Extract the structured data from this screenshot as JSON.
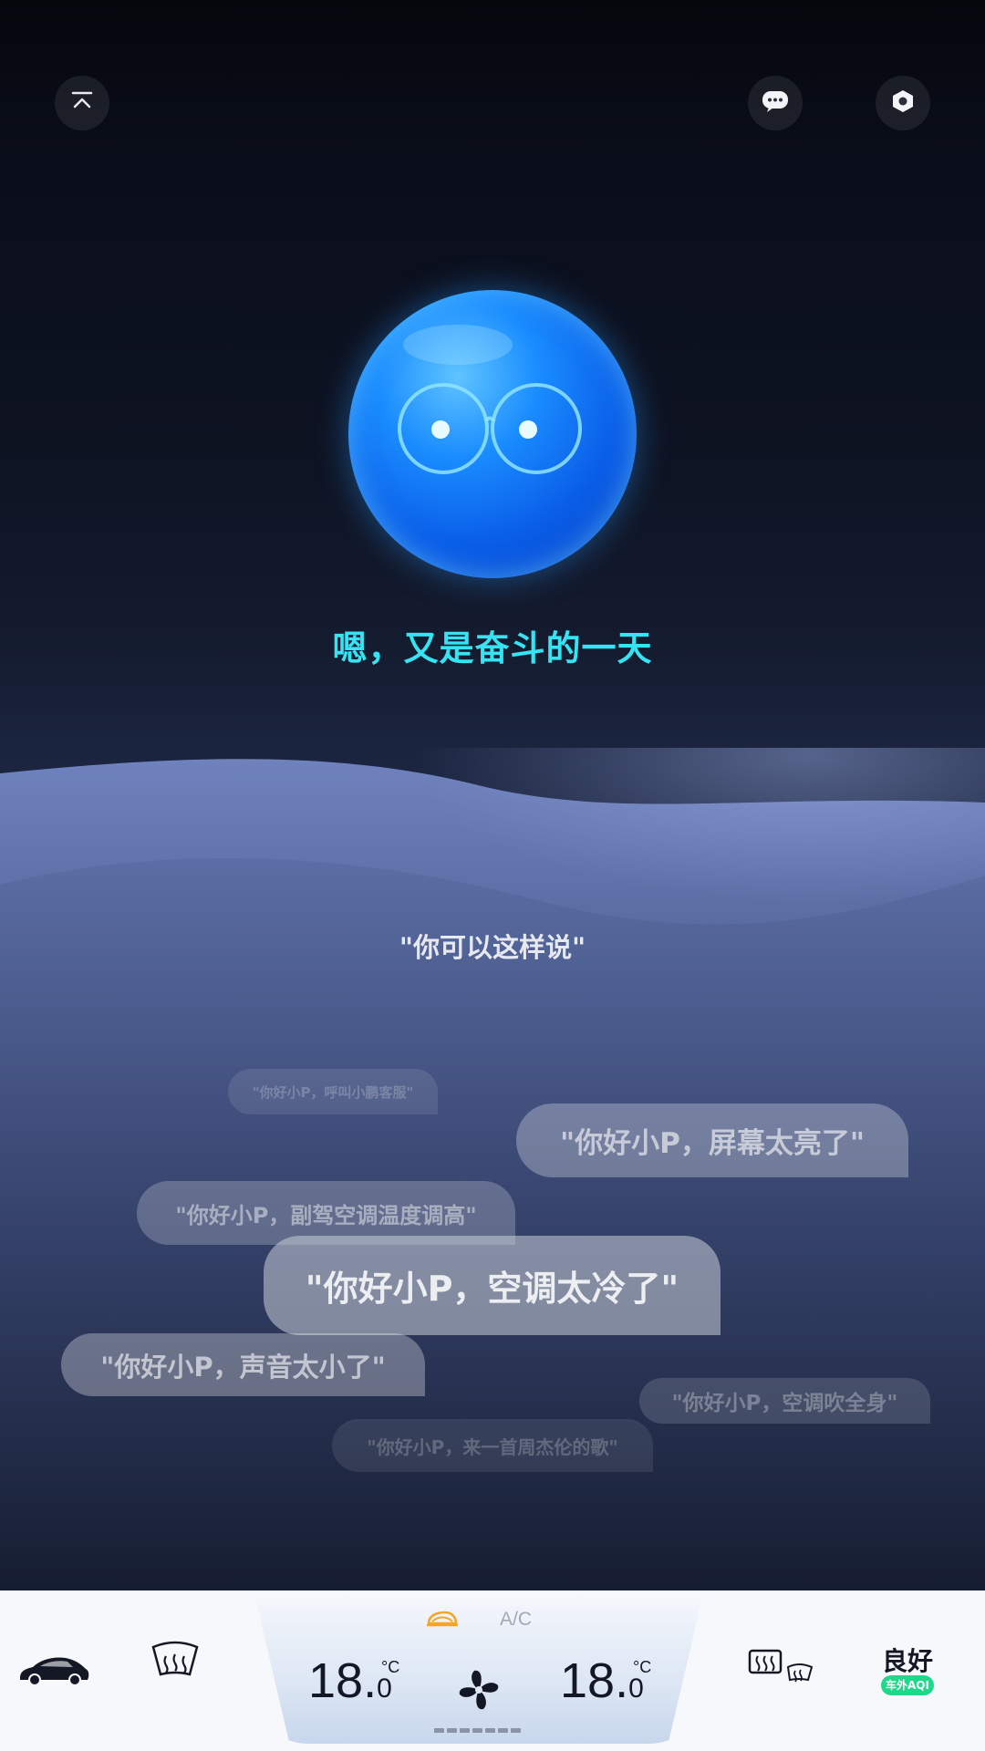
{
  "header": {
    "collapse_icon": "collapse-up-icon",
    "chat_icon": "chat-bubble-icon",
    "settings_icon": "hexagon-settings-icon"
  },
  "assistant": {
    "greeting": "嗯，又是奋斗的一天"
  },
  "suggestions": {
    "title": "\"你可以这样说\"",
    "items": [
      "\"你好小P，呼叫小鹏客服\"",
      "\"你好小P，屏幕太亮了\"",
      "\"你好小P，副驾空调温度调高\"",
      "\"你好小P，空调太冷了\"",
      "\"你好小P，声音太小了\"",
      "\"你好小P，空调吹全身\"",
      "\"你好小P，来一首周杰伦的歌\""
    ]
  },
  "climate": {
    "ac_label": "A/C",
    "left_temp_int": "18.",
    "left_temp_dec": "0",
    "right_temp_int": "18.",
    "right_temp_dec": "0",
    "unit": "°C",
    "fan_icon": "fan-icon",
    "car_icon": "car-icon",
    "front_defrost_icon": "front-defrost-icon",
    "rear_defrost_icon": "rear-defrost-icon",
    "recirc_icon": "cabin-recirculation-icon",
    "accent_color": "#f5a623"
  },
  "air_quality": {
    "value": "良好",
    "label": "车外AQI"
  }
}
